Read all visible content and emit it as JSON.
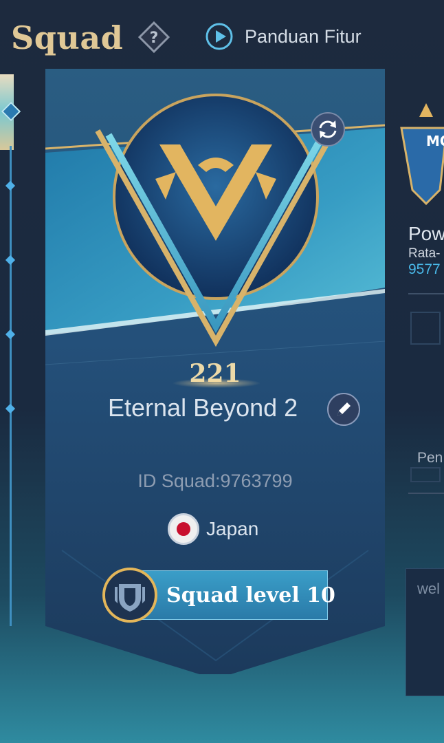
{
  "header": {
    "title": "Squad",
    "help_icon": "question-diamond-icon",
    "guide_label": "Panduan Fitur",
    "guide_icon": "play-circle-icon"
  },
  "squad": {
    "level_number": "221",
    "name": "Eternal Beyond 2",
    "id_text": "ID Squad:9763799",
    "country": "Japan",
    "level_label": "Squad level 10",
    "emblem_icon": "squad-emblem-v-icon",
    "edit_icon": "pencil-icon",
    "refresh_icon": "refresh-icon",
    "shield_icon": "shield-icon"
  },
  "right_panel": {
    "power_title": "Pow",
    "power_sub": "Rata-",
    "power_value": "9577",
    "pen_label": "Pen",
    "welcome_text": "wel"
  },
  "colors": {
    "title_gold": "#e0c896",
    "accent_blue": "#49b8e8",
    "banner_teal": "#3a9ec8"
  }
}
